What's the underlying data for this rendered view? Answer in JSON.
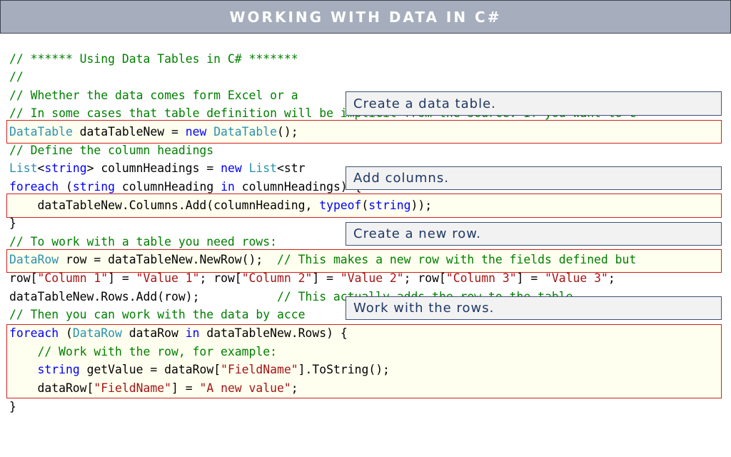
{
  "header": {
    "title": "WORKING WITH DATA IN C#"
  },
  "code": {
    "l1": "// ****** Using Data Tables in C# *******",
    "l2": "//",
    "l3": "// Whether the data comes form Excel or a",
    "l4": "// In some cases that table definition wil",
    "l4b": "l be implicit from the source. If you want to c",
    "l5": {
      "a": "DataTable",
      "b": " dataTableNew = ",
      "c": "new",
      "d": " ",
      "e": "DataTable",
      "f": "();"
    },
    "l6": "// Define the column headings",
    "l7": {
      "a": "List",
      "b": "<",
      "c": "string",
      "d": "> columnHeadings = ",
      "e": "new",
      "f": " ",
      "g": "List",
      "h": "<str"
    },
    "l8": {
      "a": "foreach",
      "b": " (",
      "c": "string",
      "d": " columnHeading ",
      "e": "in",
      "f": " columnHeadings) {"
    },
    "l9": {
      "a": "    dataTableNew.Columns.Add(columnHeading, ",
      "b": "typeof",
      "c": "(",
      "d": "string",
      "e": "));"
    },
    "l10": "}",
    "l11": "// To work with a table you need rows:",
    "l12": {
      "a": "DataRow",
      "b": " row = dataTableNew.NewRow();  ",
      "c": "// This makes a new row with the fields defined but"
    },
    "l13": {
      "a": "row[",
      "b": "\"Column 1\"",
      "c": "] = ",
      "d": "\"Value 1\"",
      "e": "; row[",
      "f": "\"Column 2\"",
      "g": "] = ",
      "h": "\"Value 2\"",
      "i": "; row[",
      "j": "\"Column 3\"",
      "k": "] = ",
      "l": "\"Value 3\"",
      "m": ";"
    },
    "l14": {
      "a": "dataTableNew.Rows.Add(row);           ",
      "b": "// This actually adds the row to the table"
    },
    "l15": "// Then you can work with the data by acce",
    "l16": {
      "a": "foreach",
      "b": " (",
      "c": "DataRow",
      "d": " dataRow ",
      "e": "in",
      "f": " dataTableNew.Rows) {"
    },
    "l17": "    // Work with the row, for example:",
    "l18": {
      "a": "    ",
      "b": "string",
      "c": " getValue = dataRow[",
      "d": "\"FieldName\"",
      "e": "].ToString();"
    },
    "l19": {
      "a": "    dataRow[",
      "b": "\"FieldName\"",
      "c": "] = ",
      "d": "\"A new value\"",
      "e": ";"
    },
    "l20": "}"
  },
  "callouts": {
    "create_table": "Create a data table.",
    "add_columns": "Add columns.",
    "create_row": "Create a new row.",
    "work_rows": "Work with the rows."
  },
  "colors": {
    "comment": "#008000",
    "keyword": "#0000ff",
    "type": "#2b91af",
    "string": "#a31515",
    "highlight_border": "#d21f1f",
    "callout_text": "#1f3864",
    "header_bg": "#a6aebd"
  }
}
